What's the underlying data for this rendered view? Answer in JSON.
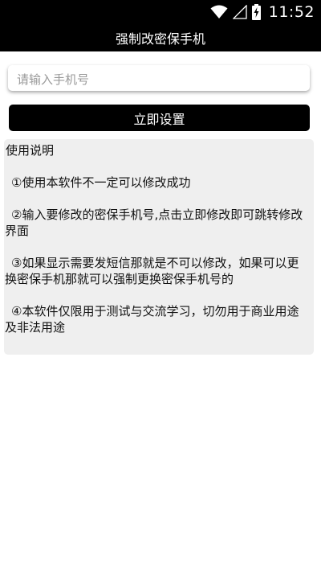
{
  "status_bar": {
    "time": "11:52",
    "icons": [
      "wifi-icon",
      "cell-signal-icon",
      "battery-charging-icon"
    ]
  },
  "app_bar": {
    "title": "强制改密保手机"
  },
  "phone_input": {
    "placeholder": "请输入手机号",
    "value": ""
  },
  "set_button": {
    "label": "立即设置"
  },
  "instructions": {
    "title": "使用说明",
    "items": [
      "①使用本软件不一定可以修改成功",
      "②输入要修改的密保手机号,点击立即修改即可跳转修改界面",
      "③如果显示需要发短信那就是不可以修改，如果可以更换密保手机那就可以强制更换密保手机号的",
      "④本软件仅限用于测试与交流学习，切勿用于商业用途及非法用途"
    ]
  },
  "colors": {
    "bar_background": "#000000",
    "panel_background": "#efefef",
    "button_background": "#000000"
  }
}
